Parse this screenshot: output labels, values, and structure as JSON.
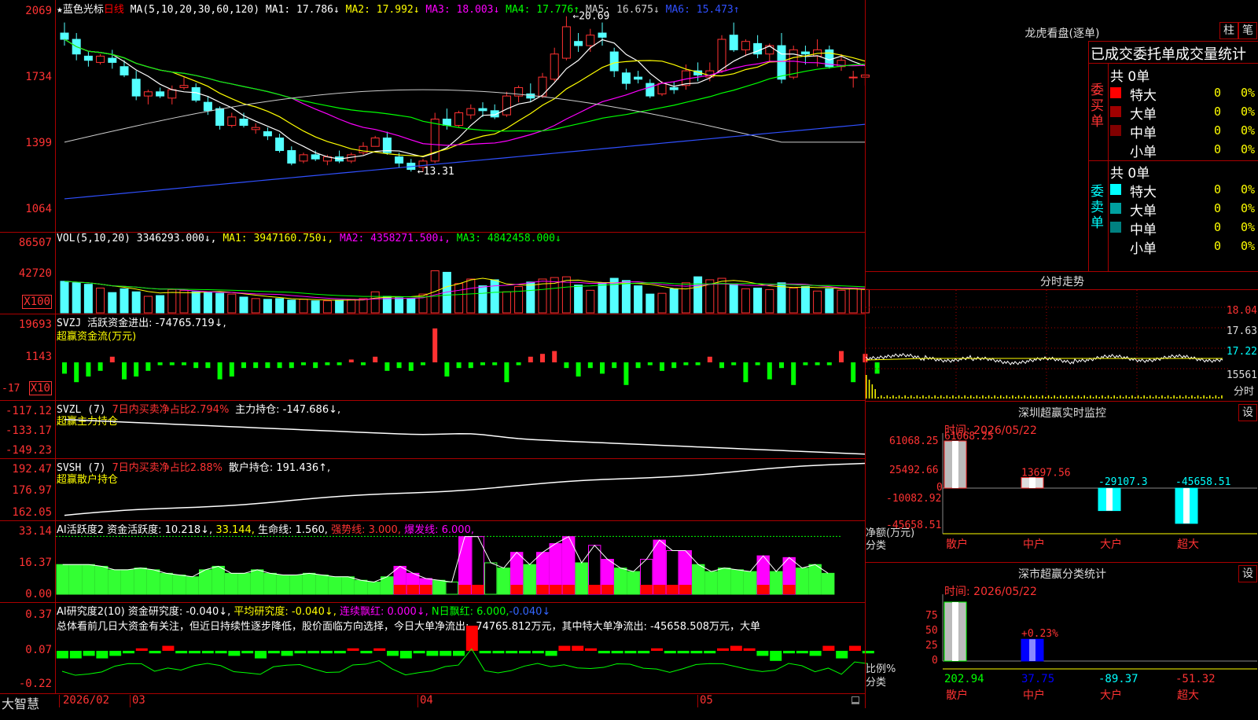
{
  "kline": {
    "star": "★",
    "stock_name": "蓝色光标",
    "period": "日线",
    "ma_params": "MA(5,10,20,30,60,120)",
    "ma_items": [
      {
        "text": "MA1: 17.786↓",
        "color": "#ffffff"
      },
      {
        "text": "MA2: 17.992↓",
        "color": "#ffff00"
      },
      {
        "text": "MA3: 18.003↓",
        "color": "#ff00ff"
      },
      {
        "text": "MA4: 17.776↑",
        "color": "#00ff00"
      },
      {
        "text": "MA5: 16.675↓",
        "color": "#cccccc"
      },
      {
        "text": "MA6: 15.473↑",
        "color": "#3050ff"
      }
    ],
    "y_ticks": [
      "2069",
      "1734",
      "1399",
      "1064"
    ],
    "high_label": "20.69",
    "low_label": "13.31",
    "price_range": [
      10.5,
      20.8
    ],
    "candles": [
      [
        19.9,
        20.4,
        19.3,
        19.6
      ],
      [
        19.6,
        19.9,
        18.6,
        18.9
      ],
      [
        18.8,
        19.0,
        18.3,
        18.6
      ],
      [
        18.5,
        18.9,
        18.4,
        18.8
      ],
      [
        18.7,
        19.1,
        18.2,
        18.5
      ],
      [
        18.3,
        18.6,
        17.8,
        17.9
      ],
      [
        17.7,
        18.1,
        16.7,
        16.9
      ],
      [
        16.9,
        17.2,
        16.5,
        17.1
      ],
      [
        17.1,
        17.3,
        16.8,
        16.9
      ],
      [
        16.8,
        17.4,
        16.5,
        17.2
      ],
      [
        17.3,
        17.8,
        17.2,
        17.4
      ],
      [
        17.3,
        17.5,
        16.6,
        16.7
      ],
      [
        16.6,
        16.9,
        16.0,
        16.2
      ],
      [
        16.3,
        16.4,
        15.3,
        15.5
      ],
      [
        15.5,
        16.1,
        15.4,
        15.9
      ],
      [
        15.8,
        16.1,
        15.4,
        15.5
      ],
      [
        15.3,
        15.6,
        15.1,
        15.4
      ],
      [
        15.2,
        15.4,
        14.8,
        15.0
      ],
      [
        14.9,
        15.1,
        14.2,
        14.3
      ],
      [
        14.3,
        14.5,
        13.6,
        13.7
      ],
      [
        13.8,
        14.2,
        13.7,
        14.1
      ],
      [
        14.1,
        14.3,
        13.8,
        13.9
      ],
      [
        13.8,
        14.1,
        13.6,
        14.0
      ],
      [
        14.0,
        14.3,
        13.7,
        13.8
      ],
      [
        13.8,
        14.2,
        13.7,
        14.1
      ],
      [
        14.2,
        14.7,
        14.1,
        14.5
      ],
      [
        14.5,
        15.0,
        14.5,
        14.9
      ],
      [
        14.9,
        15.2,
        14.1,
        14.2
      ],
      [
        14.0,
        14.2,
        13.5,
        13.7
      ],
      [
        13.7,
        13.9,
        13.3,
        13.4
      ],
      [
        13.5,
        13.9,
        13.3,
        13.8
      ],
      [
        13.8,
        16.1,
        13.7,
        15.8
      ],
      [
        15.8,
        16.3,
        15.3,
        15.5
      ],
      [
        15.5,
        16.2,
        15.4,
        16.1
      ],
      [
        16.0,
        16.5,
        15.8,
        16.3
      ],
      [
        16.3,
        16.6,
        15.9,
        16.2
      ],
      [
        16.2,
        16.5,
        15.8,
        15.9
      ],
      [
        16.0,
        17.1,
        15.9,
        16.9
      ],
      [
        16.9,
        17.4,
        16.6,
        17.3
      ],
      [
        17.0,
        17.5,
        16.6,
        16.8
      ],
      [
        16.9,
        18.0,
        16.8,
        17.8
      ],
      [
        17.7,
        19.2,
        17.6,
        18.9
      ],
      [
        18.7,
        20.7,
        18.6,
        20.2
      ],
      [
        19.5,
        19.9,
        19.0,
        19.3
      ],
      [
        19.3,
        20.1,
        19.0,
        19.8
      ],
      [
        19.9,
        20.4,
        19.3,
        19.7
      ],
      [
        19.0,
        19.2,
        17.8,
        18.1
      ],
      [
        18.0,
        18.2,
        17.2,
        17.5
      ],
      [
        17.8,
        18.1,
        17.5,
        17.7
      ],
      [
        17.5,
        17.7,
        16.8,
        16.9
      ],
      [
        17.0,
        17.6,
        16.9,
        17.5
      ],
      [
        17.3,
        17.6,
        17.0,
        17.2
      ],
      [
        17.4,
        18.4,
        17.2,
        18.1
      ],
      [
        18.1,
        18.5,
        17.6,
        17.9
      ],
      [
        17.8,
        18.5,
        17.6,
        18.1
      ],
      [
        18.1,
        19.8,
        18.0,
        19.6
      ],
      [
        19.8,
        20.4,
        19.0,
        19.1
      ],
      [
        19.1,
        19.6,
        18.8,
        19.5
      ],
      [
        19.4,
        19.8,
        18.7,
        18.9
      ],
      [
        18.9,
        19.4,
        18.5,
        19.3
      ],
      [
        19.3,
        19.9,
        17.5,
        17.7
      ],
      [
        17.8,
        19.3,
        17.7,
        19.1
      ],
      [
        19.0,
        19.3,
        18.4,
        18.9
      ],
      [
        18.8,
        19.6,
        18.3,
        19.1
      ],
      [
        19.1,
        19.3,
        18.2,
        18.3
      ],
      [
        18.3,
        18.9,
        18.1,
        18.6
      ],
      [
        17.8,
        18.1,
        17.3,
        17.8
      ],
      [
        17.8,
        18.6,
        17.4,
        17.9
      ]
    ]
  },
  "vol": {
    "title": "VOL(5,10,20)",
    "value": "3346293.000↓,",
    "ma1": "MA1: 3947160.750↓,",
    "ma2": "MA2: 4358271.500↓,",
    "ma3": "MA3: 4842458.000↓",
    "y_ticks": [
      "86507",
      "42720"
    ],
    "unit": "X100",
    "max": 90000,
    "bars": [
      42000,
      40000,
      38000,
      33000,
      27000,
      32000,
      28000,
      22000,
      23000,
      31000,
      30000,
      28000,
      27000,
      26000,
      25000,
      21000,
      19000,
      18000,
      19000,
      17000,
      18000,
      16000,
      16000,
      17000,
      18000,
      19000,
      28000,
      22000,
      20000,
      19000,
      25000,
      56000,
      54000,
      39000,
      45000,
      36000,
      44000,
      28000,
      35000,
      41000,
      45000,
      47000,
      48000,
      37000,
      30000,
      40000,
      46000,
      43000,
      36000,
      25000,
      26000,
      32000,
      40000,
      48000,
      44000,
      46000,
      38000,
      32000,
      33000,
      31000,
      40000,
      33000,
      35000,
      29000,
      32000,
      30000,
      33000,
      31000
    ]
  },
  "svzj": {
    "title": "SVZJ",
    "label": "活跃资金进出: -74765.719↓,",
    "sub": "超赢资金流(万元)",
    "y_ticks": [
      "19693",
      "1143",
      "-17"
    ],
    "unit": "X10",
    "bars": [
      -4,
      -7,
      -5,
      -3,
      2,
      -6,
      -5,
      -3,
      -1,
      -1,
      -1,
      -2,
      -2,
      -6,
      -5,
      -2,
      -2,
      -2,
      -2,
      -2,
      -1,
      -2,
      -1,
      -1,
      1,
      -1,
      2,
      -3,
      -2,
      -3,
      -1,
      12,
      -5,
      -2,
      -2,
      -1,
      -1,
      -7,
      -1,
      2,
      3,
      4,
      -2,
      -5,
      -2,
      -4,
      -2,
      -8,
      -2,
      -1,
      -3,
      -2,
      -1,
      -1,
      2,
      -2,
      -1,
      -7,
      -1,
      -6,
      -2,
      -8,
      -1,
      -1,
      -1,
      4,
      -7,
      3,
      -4
    ]
  },
  "svzl": {
    "title": "SVZL (7)",
    "ratio": "7日内买卖净占比2.794%",
    "label": "主力持仓: -147.686↓,",
    "sub": "超赢主力持仓",
    "y_ticks": [
      "-117.12",
      "-133.17",
      "-149.23"
    ],
    "range": [
      -151,
      -117
    ]
  },
  "svsh": {
    "title": "SVSH (7)",
    "ratio": "7日内买卖净占比2.88%",
    "label": "散户持仓: 191.436↑,",
    "sub": "超赢散户持仓",
    "y_ticks": [
      "192.47",
      "176.97",
      "162.05"
    ],
    "range": [
      160,
      194
    ]
  },
  "ai_active": {
    "title": "AI活跃度2",
    "fund": "资金活跃度: 10.218↓,",
    "v2": "33.144,",
    "life": "生命线: 1.560,",
    "strong": "强势线: 3.000,",
    "burst": "爆发线: 6.000,",
    "y_ticks": [
      "33.14",
      "16.37",
      "0.00"
    ],
    "max": 36,
    "bars": [
      17,
      17,
      17,
      16,
      14,
      14,
      15,
      14,
      12,
      11,
      10,
      14,
      16,
      12,
      12,
      14,
      12,
      11,
      11,
      12,
      11,
      10,
      10,
      8,
      7,
      10,
      16,
      12,
      9,
      8,
      7,
      33,
      33,
      18,
      15,
      24,
      17,
      24,
      29,
      33,
      18,
      28,
      20,
      15,
      13,
      20,
      31,
      25,
      25,
      17,
      13,
      15,
      14,
      13,
      22,
      13,
      21,
      15,
      17,
      12
    ]
  },
  "ai_research": {
    "title": "AI研究度2(10)",
    "fund": "资金研究度: -0.040↓,",
    "avg": "平均研究度: -0.040↓,",
    "cont": "连续飘红: 0.000↓,",
    "nday": "N日飘红: 6.000,",
    "nday2": "-0.040↓",
    "commentary": "总体看前几日大资金有关注，但近日持续性逐步降低，股价面临方向选择，今日大单净流出: -74765.812万元，其中特大单净流出: -45658.508万元，大单",
    "y_ticks": [
      "0.37",
      "0.07",
      "-0.22"
    ],
    "bars": [
      -3,
      -3,
      -2,
      -3,
      -2,
      -1,
      1,
      -1,
      2,
      -1,
      -1,
      -1,
      -1,
      -2,
      -1,
      -3,
      -1,
      -2,
      -1,
      -1,
      -1,
      -1,
      1,
      -1,
      1,
      -2,
      -3,
      -1,
      -2,
      -2,
      -2,
      10,
      -1,
      -1,
      -1,
      -1,
      -1,
      -2,
      2,
      2,
      1,
      -1,
      -1,
      -1,
      -1,
      1,
      -1,
      -1,
      -1,
      -1,
      1,
      2,
      1,
      -2,
      -4,
      -1,
      -1,
      -2,
      2,
      -3,
      2,
      -1
    ]
  },
  "xaxis": {
    "brand": "大智慧",
    "labels": [
      "2026/02",
      "03",
      "04",
      "05"
    ]
  },
  "right": {
    "top_title": "龙虎看盘(逐单)",
    "btn1": "柱",
    "btn2": "笔",
    "stat_title": "已成交委托单成交量统计",
    "buy_label": "委买单",
    "sell_label": "委卖单",
    "buy_total": "共 0单",
    "sell_total": "共 0单",
    "buy_rows": [
      {
        "label": "特大",
        "val": "0",
        "pct": "0%",
        "color": "#ff0000"
      },
      {
        "label": "大单",
        "val": "0",
        "pct": "0%",
        "color": "#a00000"
      },
      {
        "label": "中单",
        "val": "0",
        "pct": "0%",
        "color": "#800000"
      },
      {
        "label": "小单",
        "val": "0",
        "pct": "0%",
        "color": ""
      }
    ],
    "sell_rows": [
      {
        "label": "特大",
        "val": "0",
        "pct": "0%",
        "color": "#00ffff"
      },
      {
        "label": "大单",
        "val": "0",
        "pct": "0%",
        "color": "#00a0a0"
      },
      {
        "label": "中单",
        "val": "0",
        "pct": "0%",
        "color": "#008080"
      },
      {
        "label": "小单",
        "val": "0",
        "pct": "0%",
        "color": ""
      }
    ],
    "intraday_title": "分时走势",
    "intraday_ticks": [
      "18.04",
      "17.63",
      "17.22"
    ],
    "intraday_vol": "15561",
    "intraday_unit": "分时",
    "monitor_title": "深圳超赢实时监控",
    "monitor_set": "设",
    "monitor_time": "时间: 2026/05/22",
    "monitor_ticks": [
      "61068.25",
      "25492.66",
      "0",
      "-10082.92",
      "-45658.51"
    ],
    "monitor_ylabel": "净额(万元)",
    "monitor_xlabel": "分类",
    "monitor_cats": [
      "散户",
      "中户",
      "大户",
      "超大"
    ],
    "monitor_values": [
      61068.25,
      13697.56,
      -29107.3,
      -45658.51
    ],
    "monitor_labels": [
      "61068.25",
      "13697.56",
      "-29107.3",
      "-45658.51"
    ],
    "class_title": "深市超赢分类统计",
    "class_set": "设",
    "class_time": "时间: 2026/05/22",
    "class_ticks": [
      "75",
      "50",
      "25",
      "0"
    ],
    "class_ylabel": "比例%",
    "class_xlabel": "分类",
    "class_cats": [
      "散户",
      "中户",
      "大户",
      "超大"
    ],
    "class_pct": [
      100,
      37
    ],
    "class_pct_label": "+0.23%",
    "class_values": [
      "202.94",
      "37.75",
      "-89.37",
      "-51.32"
    ]
  }
}
